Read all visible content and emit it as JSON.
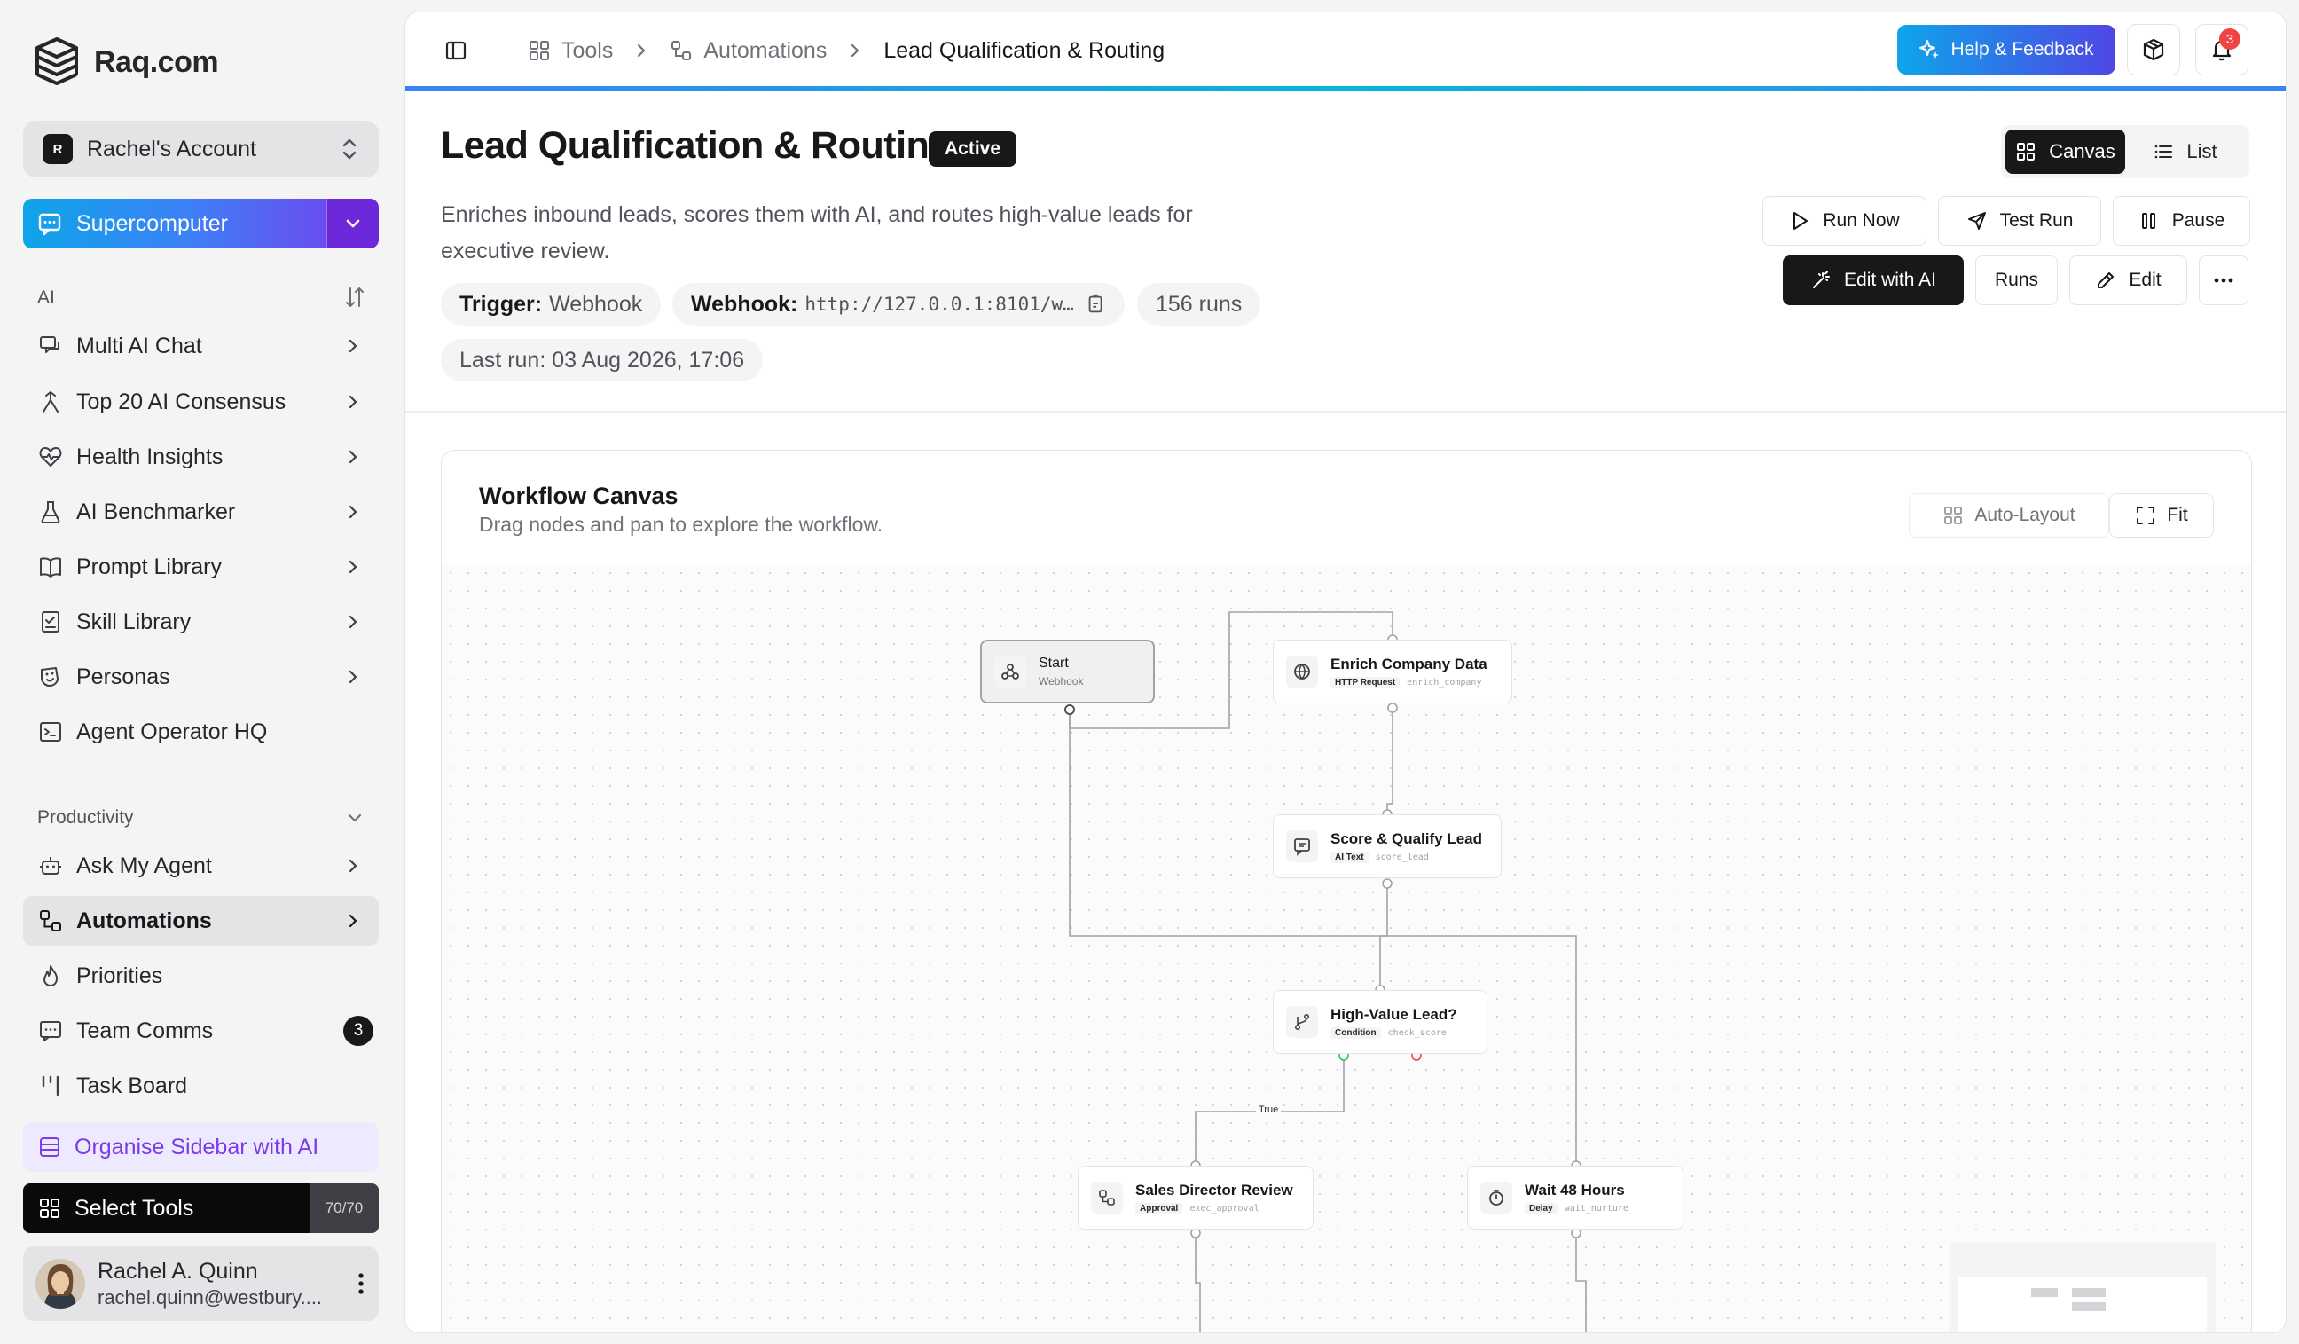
{
  "brand": {
    "name": "Raq.com"
  },
  "account": {
    "initial": "R",
    "name": "Rachel's Account"
  },
  "supercomputer": {
    "label": "Supercomputer"
  },
  "sidebar": {
    "ai_section": {
      "label": "AI"
    },
    "ai_items": [
      {
        "label": "Multi AI Chat",
        "icon": "chat-icon"
      },
      {
        "label": "Top 20 AI Consensus",
        "icon": "consensus-icon"
      },
      {
        "label": "Health Insights",
        "icon": "heart-pulse-icon"
      },
      {
        "label": "AI Benchmarker",
        "icon": "flask-icon"
      },
      {
        "label": "Prompt Library",
        "icon": "book-icon"
      },
      {
        "label": "Skill Library",
        "icon": "skill-icon"
      },
      {
        "label": "Personas",
        "icon": "persona-icon"
      },
      {
        "label": "Agent Operator HQ",
        "icon": "terminal-icon"
      }
    ],
    "productivity_section": {
      "label": "Productivity"
    },
    "productivity_items": [
      {
        "label": "Ask My Agent",
        "icon": "bot-icon"
      },
      {
        "label": "Automations",
        "icon": "workflow-icon"
      },
      {
        "label": "Priorities",
        "icon": "flame-icon"
      },
      {
        "label": "Team Comms",
        "icon": "message-icon",
        "badge": "3"
      },
      {
        "label": "Task Board",
        "icon": "kanban-icon"
      }
    ],
    "organise": {
      "label": "Organise Sidebar with AI"
    },
    "select_tools": {
      "label": "Select Tools",
      "count": "70/70"
    },
    "user": {
      "name": "Rachel A. Quinn",
      "email": "rachel.quinn@westbury...."
    }
  },
  "topbar": {
    "breadcrumbs": [
      {
        "label": "Tools"
      },
      {
        "label": "Automations"
      },
      {
        "label": "Lead Qualification & Routing"
      }
    ],
    "help_label": "Help & Feedback",
    "notification_count": "3"
  },
  "workflow": {
    "title": "Lead Qualification & Routing",
    "status": "Active",
    "description": "Enriches inbound leads, scores them with AI, and routes high-value leads for executive review.",
    "trigger_key": "Trigger:",
    "trigger_value": "Webhook",
    "webhook_key": "Webhook:",
    "webhook_value": "http://127.0.0.1:8101/w…",
    "runs_count": "156 runs",
    "last_run": "Last run: 03 Aug 2026, 17:06"
  },
  "view_toggle": {
    "canvas": "Canvas",
    "list": "List"
  },
  "actions": {
    "run_now": "Run Now",
    "test_run": "Test Run",
    "pause": "Pause",
    "edit_ai": "Edit with AI",
    "runs": "Runs",
    "edit": "Edit"
  },
  "canvas": {
    "title": "Workflow Canvas",
    "subtitle": "Drag nodes and pan to explore the workflow.",
    "auto_layout": "Auto-Layout",
    "fit": "Fit",
    "nodes": [
      {
        "title": "Start",
        "id": "Webhook"
      },
      {
        "title": "Enrich Company Data",
        "type": "HTTP Request",
        "id": "enrich_company"
      },
      {
        "title": "Score & Qualify Lead",
        "type": "AI Text",
        "id": "score_lead"
      },
      {
        "title": "High-Value Lead?",
        "type": "Condition",
        "id": "check_score"
      },
      {
        "title": "Sales Director Review",
        "type": "Approval",
        "id": "exec_approval"
      },
      {
        "title": "Wait 48 Hours",
        "type": "Delay",
        "id": "wait_nurture"
      }
    ],
    "edge_true_label": "True"
  }
}
